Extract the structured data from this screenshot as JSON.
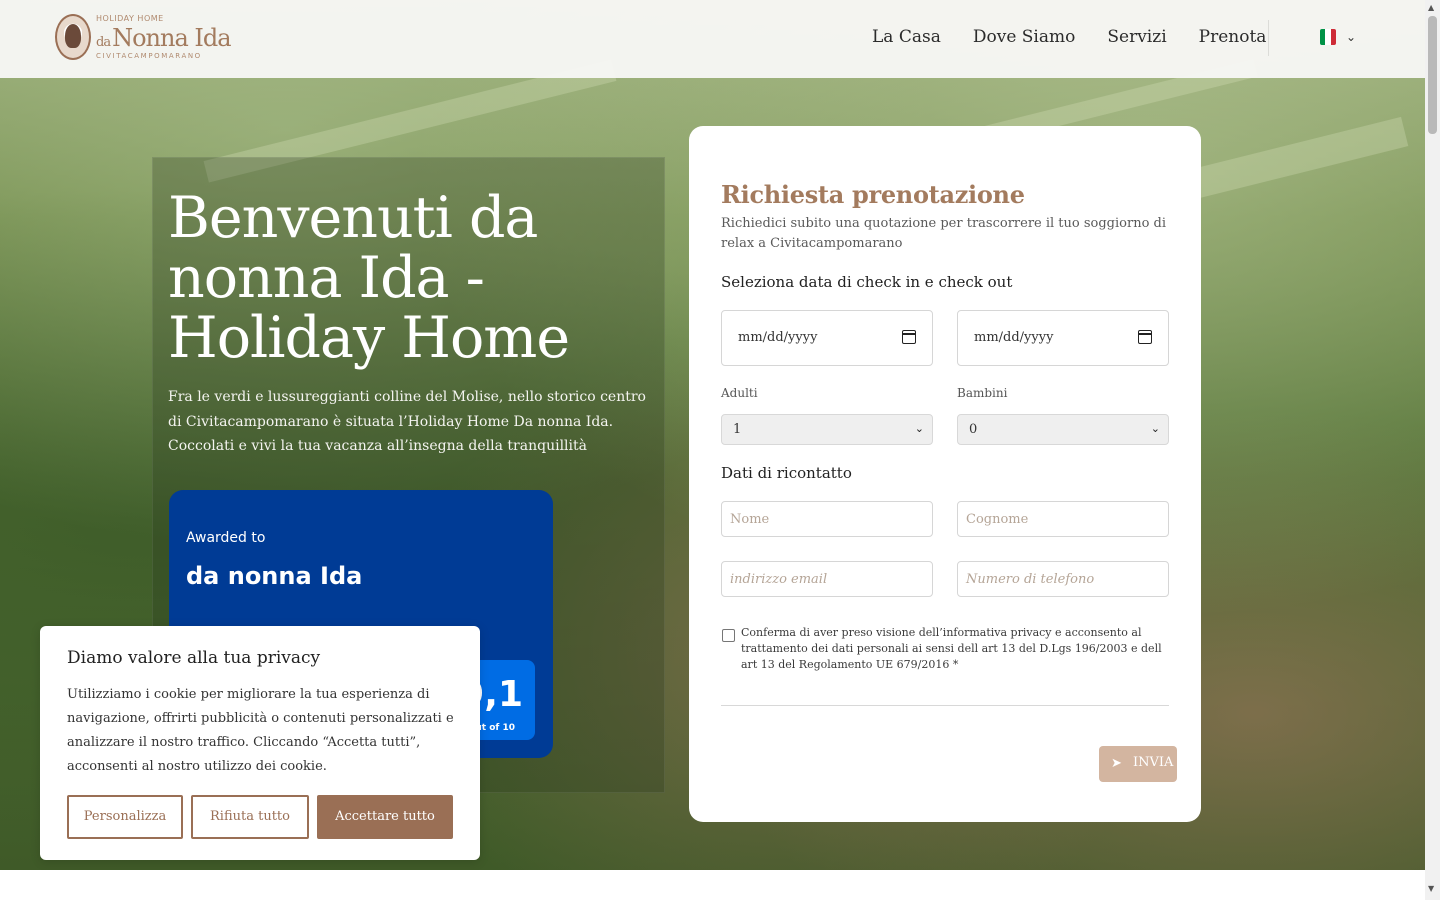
{
  "header": {
    "logo": {
      "top": "HOLIDAY HOME",
      "prefix": "da",
      "main": "Nonna Ida",
      "bottom": "CIVITACAMPOMARANO"
    },
    "nav": [
      "La Casa",
      "Dove Siamo",
      "Servizi",
      "Prenota"
    ],
    "language": {
      "flag_colors": [
        "#009246",
        "#ffffff",
        "#ce2b37"
      ],
      "icon": "chevron-down-icon"
    }
  },
  "intro": {
    "title": "Benvenuti da nonna Ida - Holiday Home",
    "text": "Fra le verdi e lussureggianti colline del Molise, nello storico centro di Civitacampomarano è situata l’Holiday Home Da nonna Ida. Coccolati e vivi la tua vacanza all’insegna della tranquillità"
  },
  "award": {
    "subtitle": "Awarded to",
    "name": "da nonna Ida",
    "score": "9,1",
    "score_of": "out of 10",
    "colors": {
      "background": "#003b95",
      "score_bg": "#006ce4"
    }
  },
  "booking_form": {
    "title": "Richiesta prenotazione",
    "description": "Richiedici subito una quotazione per trascorrere il tuo soggiorno di relax a Civitacampomarano",
    "dates_heading": "Seleziona data di check in e check out",
    "checkin_placeholder": "mm/dd/yyyy",
    "checkout_placeholder": "mm/dd/yyyy",
    "adults_label": "Adulti",
    "adults_value": "1",
    "children_label": "Bambini",
    "children_value": "0",
    "contact_heading": "Dati di ricontatto",
    "first_name_placeholder": "Nome",
    "last_name_placeholder": "Cognome",
    "email_placeholder": "indirizzo email",
    "phone_placeholder": "Numero di telefono",
    "consent": "Conferma di aver preso visione dell’informativa privacy e acconsento al trattamento dei dati personali ai sensi dell art 13 del D.Lgs 196/2003 e dell art 13 del Regolamento UE 679/2016 *",
    "submit_label": "INVIA",
    "accent_color": "#a37b5e"
  },
  "cookie_banner": {
    "title": "Diamo valore alla tua privacy",
    "text": "Utilizziamo i cookie per migliorare la tua esperienza di navigazione, offrirti pubblicità o contenuti personalizzati e analizzare il nostro traffico. Cliccando “Accetta tutti”, acconsenti al nostro utilizzo dei cookie.",
    "customize_label": "Personalizza",
    "reject_label": "Rifiuta tutto",
    "accept_label": "Accettare tutto",
    "brand_color": "#9a6f55"
  }
}
